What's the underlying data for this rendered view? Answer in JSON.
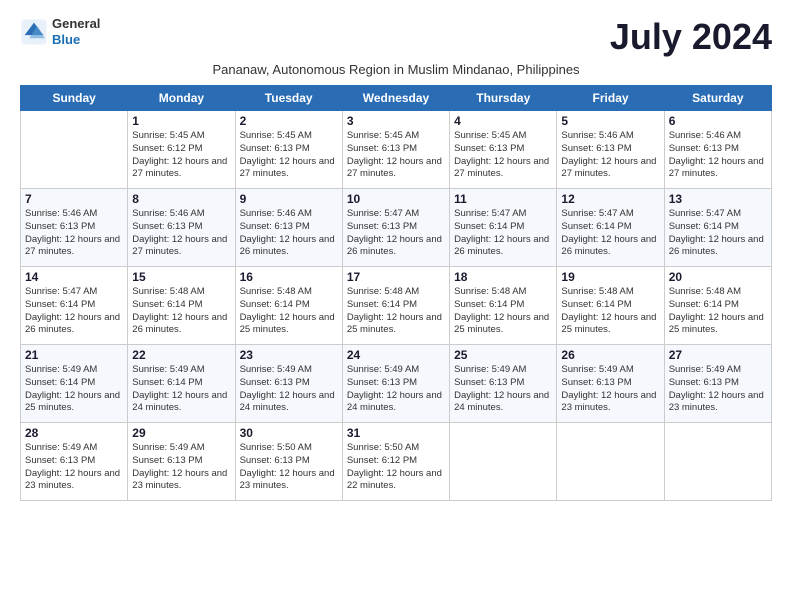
{
  "header": {
    "logo_line1": "General",
    "logo_line2": "Blue",
    "month_year": "July 2024",
    "subtitle": "Pananaw, Autonomous Region in Muslim Mindanao, Philippines"
  },
  "days_of_week": [
    "Sunday",
    "Monday",
    "Tuesday",
    "Wednesday",
    "Thursday",
    "Friday",
    "Saturday"
  ],
  "weeks": [
    [
      {
        "day": "",
        "sunrise": "",
        "sunset": "",
        "daylight": ""
      },
      {
        "day": "1",
        "sunrise": "Sunrise: 5:45 AM",
        "sunset": "Sunset: 6:12 PM",
        "daylight": "Daylight: 12 hours and 27 minutes."
      },
      {
        "day": "2",
        "sunrise": "Sunrise: 5:45 AM",
        "sunset": "Sunset: 6:13 PM",
        "daylight": "Daylight: 12 hours and 27 minutes."
      },
      {
        "day": "3",
        "sunrise": "Sunrise: 5:45 AM",
        "sunset": "Sunset: 6:13 PM",
        "daylight": "Daylight: 12 hours and 27 minutes."
      },
      {
        "day": "4",
        "sunrise": "Sunrise: 5:45 AM",
        "sunset": "Sunset: 6:13 PM",
        "daylight": "Daylight: 12 hours and 27 minutes."
      },
      {
        "day": "5",
        "sunrise": "Sunrise: 5:46 AM",
        "sunset": "Sunset: 6:13 PM",
        "daylight": "Daylight: 12 hours and 27 minutes."
      },
      {
        "day": "6",
        "sunrise": "Sunrise: 5:46 AM",
        "sunset": "Sunset: 6:13 PM",
        "daylight": "Daylight: 12 hours and 27 minutes."
      }
    ],
    [
      {
        "day": "7",
        "sunrise": "Sunrise: 5:46 AM",
        "sunset": "Sunset: 6:13 PM",
        "daylight": "Daylight: 12 hours and 27 minutes."
      },
      {
        "day": "8",
        "sunrise": "Sunrise: 5:46 AM",
        "sunset": "Sunset: 6:13 PM",
        "daylight": "Daylight: 12 hours and 27 minutes."
      },
      {
        "day": "9",
        "sunrise": "Sunrise: 5:46 AM",
        "sunset": "Sunset: 6:13 PM",
        "daylight": "Daylight: 12 hours and 26 minutes."
      },
      {
        "day": "10",
        "sunrise": "Sunrise: 5:47 AM",
        "sunset": "Sunset: 6:13 PM",
        "daylight": "Daylight: 12 hours and 26 minutes."
      },
      {
        "day": "11",
        "sunrise": "Sunrise: 5:47 AM",
        "sunset": "Sunset: 6:14 PM",
        "daylight": "Daylight: 12 hours and 26 minutes."
      },
      {
        "day": "12",
        "sunrise": "Sunrise: 5:47 AM",
        "sunset": "Sunset: 6:14 PM",
        "daylight": "Daylight: 12 hours and 26 minutes."
      },
      {
        "day": "13",
        "sunrise": "Sunrise: 5:47 AM",
        "sunset": "Sunset: 6:14 PM",
        "daylight": "Daylight: 12 hours and 26 minutes."
      }
    ],
    [
      {
        "day": "14",
        "sunrise": "Sunrise: 5:47 AM",
        "sunset": "Sunset: 6:14 PM",
        "daylight": "Daylight: 12 hours and 26 minutes."
      },
      {
        "day": "15",
        "sunrise": "Sunrise: 5:48 AM",
        "sunset": "Sunset: 6:14 PM",
        "daylight": "Daylight: 12 hours and 26 minutes."
      },
      {
        "day": "16",
        "sunrise": "Sunrise: 5:48 AM",
        "sunset": "Sunset: 6:14 PM",
        "daylight": "Daylight: 12 hours and 25 minutes."
      },
      {
        "day": "17",
        "sunrise": "Sunrise: 5:48 AM",
        "sunset": "Sunset: 6:14 PM",
        "daylight": "Daylight: 12 hours and 25 minutes."
      },
      {
        "day": "18",
        "sunrise": "Sunrise: 5:48 AM",
        "sunset": "Sunset: 6:14 PM",
        "daylight": "Daylight: 12 hours and 25 minutes."
      },
      {
        "day": "19",
        "sunrise": "Sunrise: 5:48 AM",
        "sunset": "Sunset: 6:14 PM",
        "daylight": "Daylight: 12 hours and 25 minutes."
      },
      {
        "day": "20",
        "sunrise": "Sunrise: 5:48 AM",
        "sunset": "Sunset: 6:14 PM",
        "daylight": "Daylight: 12 hours and 25 minutes."
      }
    ],
    [
      {
        "day": "21",
        "sunrise": "Sunrise: 5:49 AM",
        "sunset": "Sunset: 6:14 PM",
        "daylight": "Daylight: 12 hours and 25 minutes."
      },
      {
        "day": "22",
        "sunrise": "Sunrise: 5:49 AM",
        "sunset": "Sunset: 6:14 PM",
        "daylight": "Daylight: 12 hours and 24 minutes."
      },
      {
        "day": "23",
        "sunrise": "Sunrise: 5:49 AM",
        "sunset": "Sunset: 6:13 PM",
        "daylight": "Daylight: 12 hours and 24 minutes."
      },
      {
        "day": "24",
        "sunrise": "Sunrise: 5:49 AM",
        "sunset": "Sunset: 6:13 PM",
        "daylight": "Daylight: 12 hours and 24 minutes."
      },
      {
        "day": "25",
        "sunrise": "Sunrise: 5:49 AM",
        "sunset": "Sunset: 6:13 PM",
        "daylight": "Daylight: 12 hours and 24 minutes."
      },
      {
        "day": "26",
        "sunrise": "Sunrise: 5:49 AM",
        "sunset": "Sunset: 6:13 PM",
        "daylight": "Daylight: 12 hours and 23 minutes."
      },
      {
        "day": "27",
        "sunrise": "Sunrise: 5:49 AM",
        "sunset": "Sunset: 6:13 PM",
        "daylight": "Daylight: 12 hours and 23 minutes."
      }
    ],
    [
      {
        "day": "28",
        "sunrise": "Sunrise: 5:49 AM",
        "sunset": "Sunset: 6:13 PM",
        "daylight": "Daylight: 12 hours and 23 minutes."
      },
      {
        "day": "29",
        "sunrise": "Sunrise: 5:49 AM",
        "sunset": "Sunset: 6:13 PM",
        "daylight": "Daylight: 12 hours and 23 minutes."
      },
      {
        "day": "30",
        "sunrise": "Sunrise: 5:50 AM",
        "sunset": "Sunset: 6:13 PM",
        "daylight": "Daylight: 12 hours and 23 minutes."
      },
      {
        "day": "31",
        "sunrise": "Sunrise: 5:50 AM",
        "sunset": "Sunset: 6:12 PM",
        "daylight": "Daylight: 12 hours and 22 minutes."
      },
      {
        "day": "",
        "sunrise": "",
        "sunset": "",
        "daylight": ""
      },
      {
        "day": "",
        "sunrise": "",
        "sunset": "",
        "daylight": ""
      },
      {
        "day": "",
        "sunrise": "",
        "sunset": "",
        "daylight": ""
      }
    ]
  ]
}
